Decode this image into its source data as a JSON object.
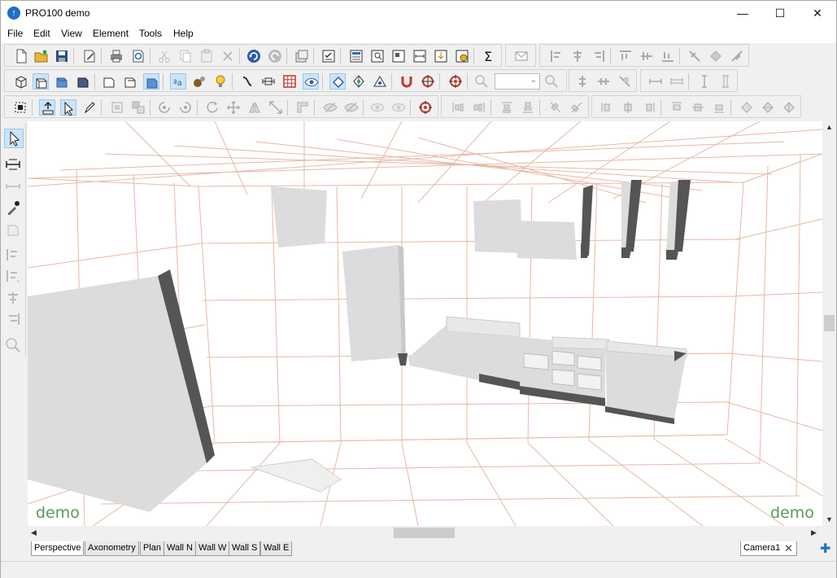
{
  "window": {
    "title": "PRO100 demo",
    "minimize": "—",
    "maximize": "☐",
    "close": "✕"
  },
  "menu": [
    "File",
    "Edit",
    "View",
    "Element",
    "Tools",
    "Help"
  ],
  "viewport": {
    "watermark_left": "demo",
    "watermark_right": "demo"
  },
  "tabs": [
    "Perspective",
    "Axonometry",
    "Plan",
    "Wall N",
    "Wall W",
    "Wall S",
    "Wall E"
  ],
  "camera_tab": {
    "label": "Camera1",
    "close": "✕",
    "add": "✚"
  },
  "colors": {
    "grid": "#e9b8a6",
    "furniture": "#dcdcdc",
    "furniture_dark": "#555555",
    "accent": "#1e6fc8",
    "watermark": "#5a9a5a"
  }
}
